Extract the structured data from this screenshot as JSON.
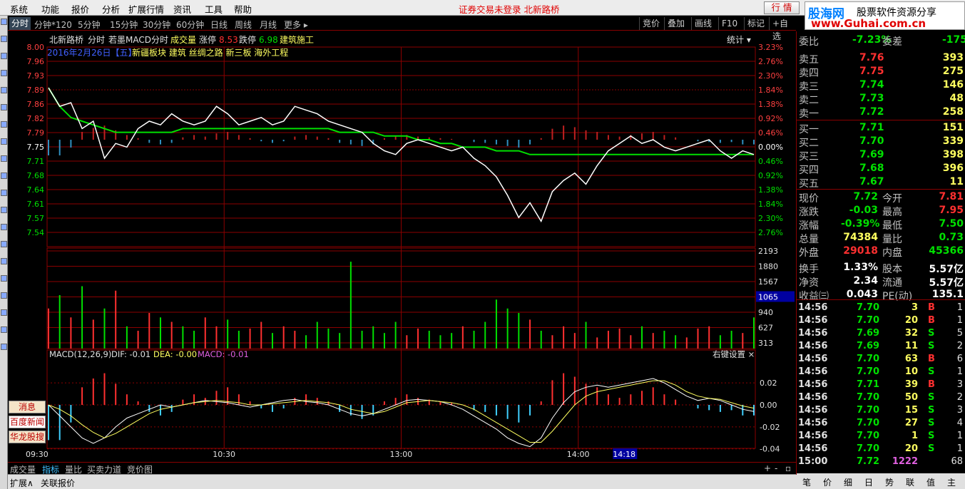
{
  "menu": [
    "系统",
    "功能",
    "报价",
    "分析",
    "扩展行情",
    "资讯",
    "工具",
    "帮助"
  ],
  "status_text": "证券交易未登录   北新路桥",
  "quote_button": "行 情",
  "logo": {
    "brand": "股海网",
    "slogan": "股票软件资源分享",
    "url": "www.Guhai.com.cn"
  },
  "tabs": [
    "分时",
    "分钟*120",
    "5分钟",
    "15分钟",
    "30分钟",
    "60分钟",
    "日线",
    "周线",
    "月线",
    "更多 ▸"
  ],
  "toolbar": [
    "竞价",
    "叠加",
    "画线",
    "F10",
    "标记",
    "+自选"
  ],
  "info": {
    "stock": "北新路桥",
    "mode": "分时",
    "indicator": "若墨MACD分时",
    "vol_label": "成交量",
    "up_label": "涨停",
    "up_value": "8.53",
    "down_label": "跌停",
    "down_value": "6.98",
    "sector": "建筑施工",
    "date": "2016年2月26日【五】",
    "tags": "新疆板块 建筑    丝绸之路 新三板 海外工程",
    "stats_label": "统计 ▾"
  },
  "price_axis": [
    "8.00",
    "7.96",
    "7.93",
    "7.89",
    "7.86",
    "7.82",
    "7.79",
    "7.75",
    "7.71",
    "7.68",
    "7.64",
    "7.61",
    "7.57",
    "7.54"
  ],
  "pct_axis": [
    "3.23%",
    "2.76%",
    "2.30%",
    "1.84%",
    "1.38%",
    "0.92%",
    "0.46%",
    "0.00%",
    "0.46%",
    "0.92%",
    "1.38%",
    "1.84%",
    "2.30%",
    "2.76%"
  ],
  "vol_axis": [
    "2193",
    "1880",
    "1567",
    "1065",
    "940",
    "627",
    "313"
  ],
  "macd": {
    "title": "MACD(12,26,9)",
    "dif": "DIF: -0.01",
    "dea": "DEA: -0.00",
    "macd": "MACD: -0.01",
    "settings": "右键设置 ×",
    "axis": [
      "0.02",
      "0.00",
      "-0.02",
      "-0.04"
    ]
  },
  "time_axis": [
    "09:30",
    "10:30",
    "13:00",
    "14:00",
    "14:18"
  ],
  "side_buttons": [
    "消息",
    "百度新闻",
    "华龙股搜"
  ],
  "bottom_tabs": [
    "成交量",
    "指标",
    "量比",
    "买卖力道",
    "竞价图"
  ],
  "ext_tabs": [
    "扩展∧",
    "关联报价"
  ],
  "order_book": {
    "top": {
      "label": "委比",
      "value": "-7.23%",
      "label2": "委差",
      "value2": "-175"
    },
    "asks": [
      {
        "label": "卖五",
        "price": "7.76",
        "vol": "393"
      },
      {
        "label": "卖四",
        "price": "7.75",
        "vol": "275"
      },
      {
        "label": "卖三",
        "price": "7.74",
        "vol": "146"
      },
      {
        "label": "卖二",
        "price": "7.73",
        "vol": "48"
      },
      {
        "label": "卖一",
        "price": "7.72",
        "vol": "258"
      }
    ],
    "bids": [
      {
        "label": "买一",
        "price": "7.71",
        "vol": "151"
      },
      {
        "label": "买二",
        "price": "7.70",
        "vol": "339"
      },
      {
        "label": "买三",
        "price": "7.69",
        "vol": "398"
      },
      {
        "label": "买四",
        "price": "7.68",
        "vol": "396"
      },
      {
        "label": "买五",
        "price": "7.67",
        "vol": "11"
      }
    ]
  },
  "quote": [
    {
      "l1": "现价",
      "v1": "7.72",
      "l2": "今开",
      "v2": "7.81",
      "c1": "#00e000",
      "c2": "#ff3030"
    },
    {
      "l1": "涨跌",
      "v1": "-0.03",
      "l2": "最高",
      "v2": "7.95",
      "c1": "#00e000",
      "c2": "#ff3030"
    },
    {
      "l1": "涨幅",
      "v1": "-0.39%",
      "l2": "最低",
      "v2": "7.50",
      "c1": "#00e000",
      "c2": "#00e000"
    },
    {
      "l1": "总量",
      "v1": "74384",
      "l2": "量比",
      "v2": "0.73",
      "c1": "#ffff60",
      "c2": "#00e000"
    },
    {
      "l1": "外盘",
      "v1": "29018",
      "l2": "内盘",
      "v2": "45366",
      "c1": "#ff3030",
      "c2": "#00e000"
    },
    {
      "l1": "换手",
      "v1": "1.33%",
      "l2": "股本",
      "v2": "5.57亿",
      "c1": "#ffffff",
      "c2": "#ffffff"
    },
    {
      "l1": "净资",
      "v1": "2.34",
      "l2": "流通",
      "v2": "5.57亿",
      "c1": "#ffffff",
      "c2": "#ffffff"
    },
    {
      "l1": "收益㈢",
      "v1": "0.043",
      "l2": "PE(动)",
      "v2": "135.1",
      "c1": "#ffffff",
      "c2": "#ffffff"
    }
  ],
  "ticks": [
    {
      "t": "14:56",
      "p": "7.70",
      "v": "3",
      "d": "B",
      "n": "1"
    },
    {
      "t": "14:56",
      "p": "7.70",
      "v": "20",
      "d": "B",
      "n": "1"
    },
    {
      "t": "14:56",
      "p": "7.69",
      "v": "32",
      "d": "S",
      "n": "5"
    },
    {
      "t": "14:56",
      "p": "7.69",
      "v": "11",
      "d": "S",
      "n": "2"
    },
    {
      "t": "14:56",
      "p": "7.70",
      "v": "63",
      "d": "B",
      "n": "6"
    },
    {
      "t": "14:56",
      "p": "7.70",
      "v": "10",
      "d": "S",
      "n": "1"
    },
    {
      "t": "14:56",
      "p": "7.71",
      "v": "39",
      "d": "B",
      "n": "3"
    },
    {
      "t": "14:56",
      "p": "7.70",
      "v": "50",
      "d": "S",
      "n": "2"
    },
    {
      "t": "14:56",
      "p": "7.70",
      "v": "15",
      "d": "S",
      "n": "3"
    },
    {
      "t": "14:56",
      "p": "7.70",
      "v": "27",
      "d": "S",
      "n": "4"
    },
    {
      "t": "14:56",
      "p": "7.70",
      "v": "1",
      "d": "S",
      "n": "1"
    },
    {
      "t": "14:56",
      "p": "7.70",
      "v": "20",
      "d": "S",
      "n": "1"
    },
    {
      "t": "15:00",
      "p": "7.72",
      "v": "1222",
      "d": "",
      "n": "68"
    }
  ],
  "right_tabs": [
    "笔",
    "价",
    "细",
    "日",
    "势",
    "联",
    "值",
    "主"
  ],
  "chart_data": {
    "type": "line",
    "prev_close": 7.75,
    "price_range": [
      7.5,
      8.0
    ],
    "price": [
      7.89,
      7.84,
      7.85,
      7.78,
      7.8,
      7.7,
      7.74,
      7.73,
      7.78,
      7.8,
      7.79,
      7.82,
      7.8,
      7.79,
      7.8,
      7.84,
      7.82,
      7.79,
      7.8,
      7.81,
      7.79,
      7.8,
      7.84,
      7.83,
      7.82,
      7.8,
      7.79,
      7.78,
      7.77,
      7.74,
      7.72,
      7.71,
      7.74,
      7.75,
      7.74,
      7.73,
      7.72,
      7.73,
      7.7,
      7.68,
      7.65,
      7.6,
      7.54,
      7.58,
      7.53,
      7.61,
      7.64,
      7.66,
      7.63,
      7.68,
      7.72,
      7.74,
      7.76,
      7.74,
      7.75,
      7.73,
      7.72,
      7.73,
      7.74,
      7.75,
      7.72,
      7.7,
      7.72,
      7.71
    ],
    "avg": [
      7.89,
      7.84,
      7.81,
      7.8,
      7.79,
      7.78,
      7.77,
      7.77,
      7.77,
      7.77,
      7.77,
      7.77,
      7.78,
      7.78,
      7.78,
      7.78,
      7.78,
      7.78,
      7.78,
      7.78,
      7.78,
      7.78,
      7.78,
      7.78,
      7.78,
      7.78,
      7.77,
      7.77,
      7.77,
      7.77,
      7.76,
      7.76,
      7.76,
      7.75,
      7.75,
      7.74,
      7.74,
      7.73,
      7.73,
      7.73,
      7.72,
      7.72,
      7.72,
      7.71,
      7.71,
      7.71,
      7.71,
      7.71,
      7.71,
      7.71,
      7.71,
      7.71,
      7.71,
      7.71,
      7.71,
      7.71,
      7.71,
      7.71,
      7.71,
      7.71,
      7.71,
      7.71,
      7.71,
      7.71
    ],
    "volume": [
      900,
      1200,
      700,
      1400,
      650,
      900,
      1300,
      500,
      400,
      800,
      700,
      600,
      500,
      400,
      700,
      500,
      650,
      400,
      450,
      600,
      350,
      500,
      400,
      300,
      600,
      450,
      350,
      1950,
      400,
      500,
      350,
      600,
      300,
      450,
      400,
      300,
      350,
      500,
      400,
      600,
      1100,
      900,
      800,
      650,
      400,
      300,
      500,
      350,
      600,
      250,
      400,
      450,
      300,
      500,
      350,
      400,
      300,
      250,
      450,
      500,
      300,
      400,
      350,
      700
    ],
    "macd_hist": [
      -0.02,
      -0.02,
      -0.01,
      0.01,
      0.015,
      0.018,
      0.012,
      0.006,
      0.002,
      -0.004,
      -0.006,
      -0.004,
      0.003,
      0.006,
      0.004,
      0.008,
      0.01,
      0.006,
      0.002,
      -0.002,
      -0.004,
      -0.002,
      0.004,
      0.006,
      0.004,
      0.002,
      -0.004,
      -0.006,
      -0.008,
      -0.006,
      0.002,
      0.004,
      0.006,
      0.004,
      0.003,
      0.002,
      0.001,
      0.0,
      -0.003,
      -0.004,
      -0.006,
      -0.008,
      -0.01,
      -0.006,
      0.002,
      0.014,
      0.018,
      0.016,
      0.012,
      0.01,
      0.006,
      0.004,
      0.006,
      0.008,
      0.01,
      0.006,
      0.003,
      0.0,
      -0.002,
      -0.003,
      -0.004,
      -0.003,
      -0.006,
      -0.006
    ],
    "dif": [
      0.0,
      -0.01,
      -0.02,
      -0.03,
      -0.035,
      -0.03,
      -0.02,
      -0.012,
      -0.008,
      -0.004,
      0.0,
      -0.002,
      0.0,
      0.002,
      0.004,
      0.003,
      0.002,
      0.0,
      -0.002,
      0.0,
      0.002,
      0.004,
      0.005,
      0.003,
      0.002,
      0.0,
      -0.004,
      -0.008,
      -0.01,
      -0.008,
      -0.004,
      0.0,
      0.004,
      0.005,
      0.004,
      0.003,
      0.0,
      -0.004,
      -0.01,
      -0.016,
      -0.022,
      -0.03,
      -0.035,
      -0.038,
      -0.03,
      -0.012,
      0.002,
      0.012,
      0.016,
      0.018,
      0.016,
      0.018,
      0.02,
      0.022,
      0.024,
      0.02,
      0.014,
      0.008,
      0.004,
      0.006,
      0.004,
      0.0,
      -0.004,
      -0.006
    ],
    "dea": [
      0.0,
      -0.004,
      -0.01,
      -0.018,
      -0.025,
      -0.03,
      -0.026,
      -0.02,
      -0.014,
      -0.008,
      -0.004,
      -0.002,
      0.0,
      0.002,
      0.003,
      0.004,
      0.003,
      0.002,
      0.0,
      0.0,
      0.001,
      0.002,
      0.003,
      0.004,
      0.003,
      0.002,
      0.0,
      -0.004,
      -0.006,
      -0.008,
      -0.006,
      -0.002,
      0.002,
      0.003,
      0.004,
      0.003,
      0.002,
      0.0,
      -0.004,
      -0.01,
      -0.016,
      -0.022,
      -0.028,
      -0.034,
      -0.034,
      -0.024,
      -0.012,
      0.0,
      0.008,
      0.012,
      0.014,
      0.016,
      0.018,
      0.02,
      0.022,
      0.022,
      0.018,
      0.012,
      0.008,
      0.006,
      0.005,
      0.002,
      -0.001,
      -0.003
    ]
  }
}
